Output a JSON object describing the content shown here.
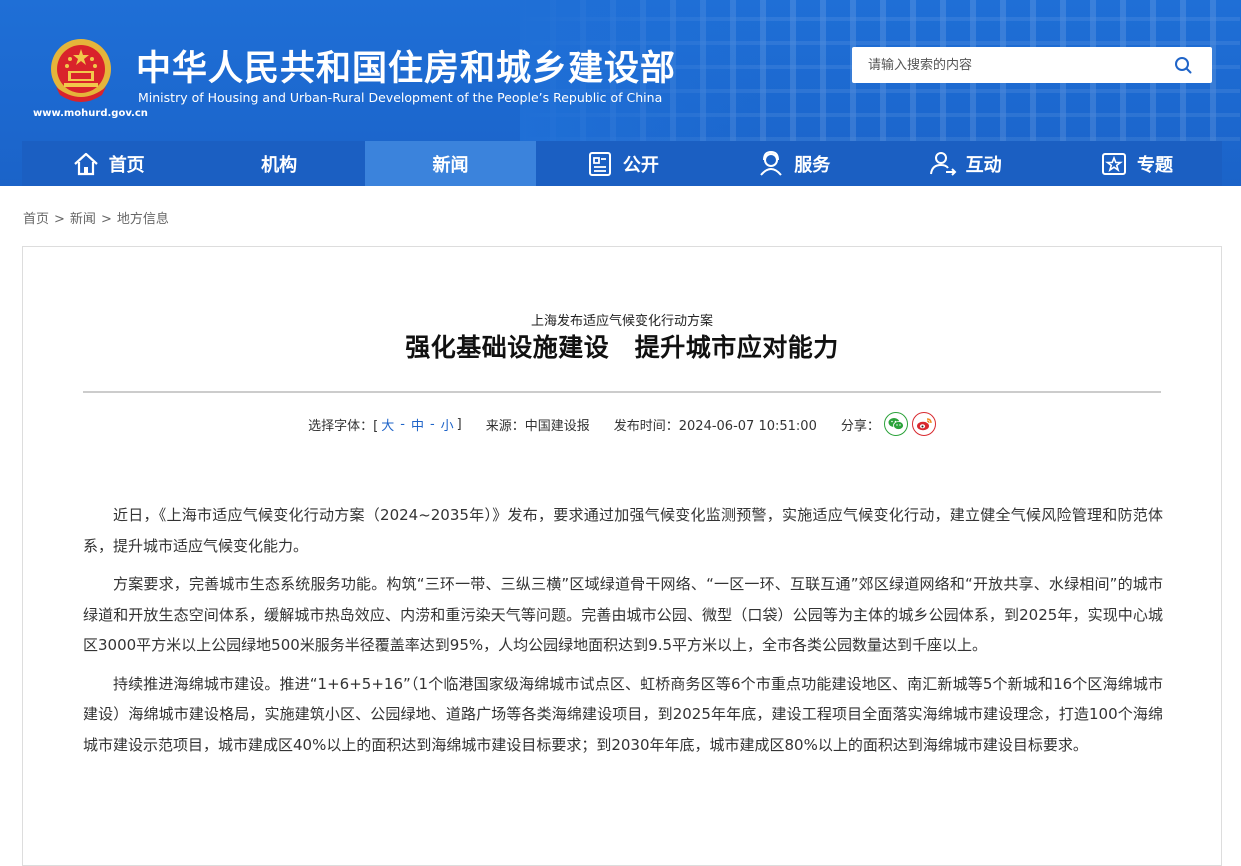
{
  "header": {
    "site_url": "www.mohurd.gov.cn",
    "title_cn": "中华人民共和国住房和城乡建设部",
    "title_en": "Ministry of Housing and Urban-Rural Development of the People’s Republic of China",
    "search_placeholder": "请输入搜索的内容"
  },
  "nav": {
    "items": [
      {
        "label": "首页",
        "icon": "home-icon"
      },
      {
        "label": "机构",
        "icon": ""
      },
      {
        "label": "新闻",
        "icon": "",
        "active": true
      },
      {
        "label": "公开",
        "icon": "document-icon"
      },
      {
        "label": "服务",
        "icon": "service-icon"
      },
      {
        "label": "互动",
        "icon": "interaction-icon"
      },
      {
        "label": "专题",
        "icon": "special-topic-icon"
      }
    ]
  },
  "breadcrumb": [
    "首页",
    "新闻",
    "地方信息"
  ],
  "breadcrumb_sep": ">",
  "article": {
    "subtitle": "上海发布适应气候变化行动方案",
    "headline": "强化基础设施建设　提升城市应对能力",
    "font_label": "选择字体：[",
    "font_large": "大",
    "font_medium": "中",
    "font_small": "小",
    "font_close": "]",
    "font_dash": "-",
    "source": "来源：中国建设报",
    "publish_time": "发布时间：2024-06-07 10:51:00",
    "share_label": "分享：",
    "paragraphs": [
      "近日，《上海市适应气候变化行动方案（2024~2035年）》发布，要求通过加强气候变化监测预警，实施适应气候变化行动，建立健全气候风险管理和防范体系，提升城市适应气候变化能力。",
      "方案要求，完善城市生态系统服务功能。构筑“三环一带、三纵三横”区域绿道骨干网络、“一区一环、互联互通”郊区绿道网络和“开放共享、水绿相间”的城市绿道和开放生态空间体系，缓解城市热岛效应、内涝和重污染天气等问题。完善由城市公园、微型（口袋）公园等为主体的城乡公园体系，到2025年，实现中心城区3000平方米以上公园绿地500米服务半径覆盖率达到95%，人均公园绿地面积达到9.5平方米以上，全市各类公园数量达到千座以上。",
      "持续推进海绵城市建设。推进“1+6+5+16”（1个临港国家级海绵城市试点区、虹桥商务区等6个市重点功能建设地区、南汇新城等5个新城和16个区海绵城市建设）海绵城市建设格局，实施建筑小区、公园绿地、道路广场等各类海绵建设项目，到2025年年底，建设工程项目全面落实海绵城市建设理念，打造100个海绵城市建设示范项目，城市建成区40%以上的面积达到海绵城市建设目标要求；到2030年年底，城市建成区80%以上的面积达到海绵城市建设目标要求。"
    ]
  },
  "colors": {
    "header_blue": "#1c68cf",
    "nav_blue": "#1b5fc2",
    "nav_active": "#3b83dc",
    "link_blue": "#1f64c8",
    "wechat_green": "#2ba23a",
    "weibo_red": "#d8292f"
  }
}
